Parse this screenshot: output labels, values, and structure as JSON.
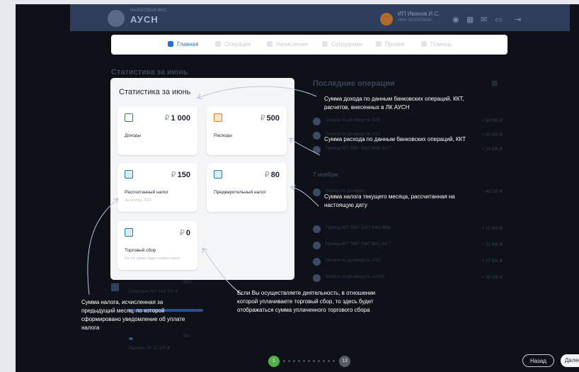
{
  "header": {
    "logo_text": "АУСН",
    "logo_sub": "НАЛОГОВАЯ ФНС",
    "user_name": "ИП Иванов И.С.",
    "user_sub": "ИНН 0000000000"
  },
  "nav": {
    "items": [
      {
        "label": "Главная",
        "active": true
      },
      {
        "label": "Операции",
        "active": false
      },
      {
        "label": "Начисления",
        "active": false
      },
      {
        "label": "Сотрудники",
        "active": false
      },
      {
        "label": "Прочее",
        "active": false
      },
      {
        "label": "Помощь",
        "active": false
      }
    ]
  },
  "background": {
    "stats_heading": "Статистика за июнь",
    "ops_heading": "Последние операции",
    "date_label": "7 ноября",
    "bottom_label1": "Операции ККТ 141 708 ₽",
    "bottom_label2": "Расчеты ЛК 32 200 ₽",
    "bottom_pct": "35%",
    "bottom_pct2": "5%"
  },
  "stats": {
    "title": "Статистика за июнь",
    "currency": "₽",
    "tiles": [
      {
        "label": "Доходы",
        "value": "1 000",
        "sub": ""
      },
      {
        "label": "Расходы",
        "value": "500",
        "sub": ""
      },
      {
        "label": "Рассчитанный налог",
        "value": "150",
        "sub": "За октябрь 2022"
      },
      {
        "label": "Предварительный налог",
        "value": "80",
        "sub": ""
      },
      {
        "label": "Торговый сбор",
        "value": "0",
        "sub": "На эту сумму будет снижен налог"
      }
    ]
  },
  "callouts": {
    "income": "Сумма дохода по данным банковских операций, ККТ, расчетов, внесенных в ЛК АУСН",
    "expense": "Сумма расхода по данным банковских операций, ККТ",
    "current_tax": "Сумма налога текущего месяца, рассчитанная на настоящую дату",
    "trade_fee": "Если Вы осуществляете деятельность, в отношении которой уплачиваете торговый сбор, то здесь будет отображаться сумма уплаченного торгового сбора",
    "calc_tax": "Сумма налога, исчисленная за предыдущий месяц, по которой сформировано уведомление об уплате налога"
  },
  "pager": {
    "first": "1",
    "last": "13"
  },
  "buttons": {
    "back": "Назад",
    "next": "Далее"
  }
}
